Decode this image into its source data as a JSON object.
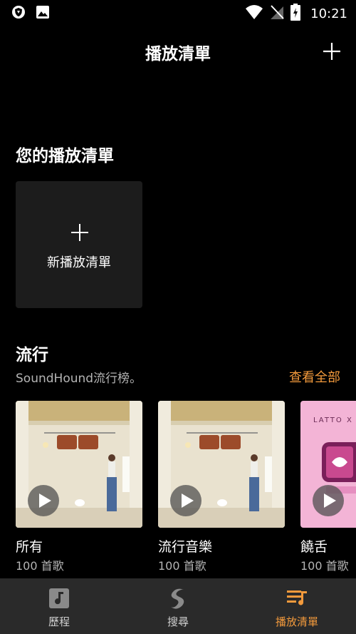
{
  "status_bar": {
    "time": "10:21",
    "icons": [
      "shield-icon",
      "image-icon",
      "wifi-icon",
      "no-sim-icon",
      "battery-charging-icon"
    ]
  },
  "header": {
    "title": "播放清單",
    "add_icon": "plus-icon"
  },
  "your_playlists": {
    "title": "您的播放清單",
    "new_playlist_label": "新播放清單"
  },
  "trending": {
    "title": "流行",
    "subtitle": "SoundHound流行榜。",
    "see_all": "查看全部",
    "cards": [
      {
        "name": "所有",
        "count": "100 首歌"
      },
      {
        "name": "流行音樂",
        "count": "100 首歌"
      },
      {
        "name": "饒舌",
        "count": "100 首歌",
        "art_text": "LATTO X M"
      }
    ]
  },
  "bottom_nav": {
    "items": [
      {
        "label": "歷程",
        "icon": "music-note-icon",
        "active": false
      },
      {
        "label": "搜尋",
        "icon": "soundhound-logo-icon",
        "active": false
      },
      {
        "label": "播放清單",
        "icon": "playlist-icon",
        "active": true
      }
    ]
  },
  "colors": {
    "accent": "#f39a3c",
    "background": "#000000",
    "nav_background": "#2a2a2a",
    "card_background": "#1c1c1c"
  }
}
